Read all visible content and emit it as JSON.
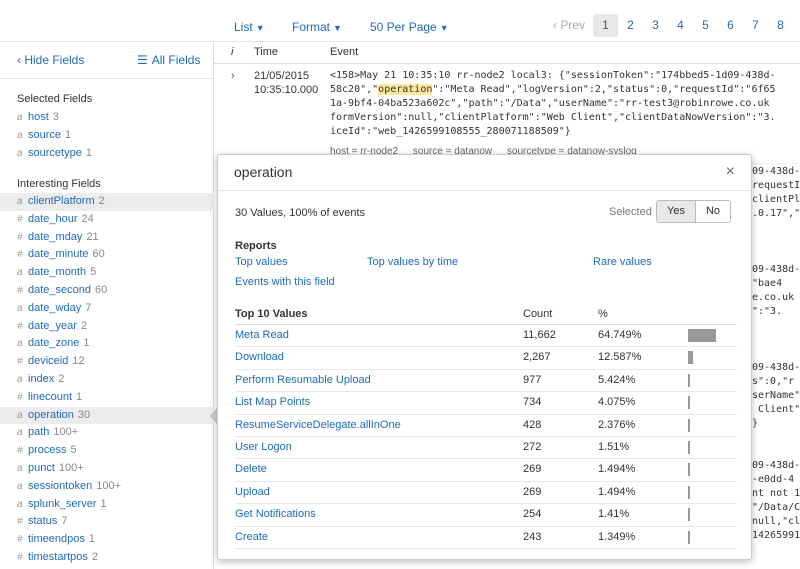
{
  "toolbar": {
    "list_label": "List",
    "format_label": "Format",
    "per_page_label": "50 Per Page",
    "prev_label": "‹ Prev",
    "pages": [
      "1",
      "2",
      "3",
      "4",
      "5",
      "6",
      "7",
      "8"
    ],
    "active_page": "1"
  },
  "sidebar": {
    "hide_fields": "‹ Hide Fields",
    "all_fields": "All Fields",
    "selected_heading": "Selected Fields",
    "selected": [
      {
        "type": "a",
        "name": "host",
        "count": "3"
      },
      {
        "type": "a",
        "name": "source",
        "count": "1"
      },
      {
        "type": "a",
        "name": "sourcetype",
        "count": "1"
      }
    ],
    "interesting_heading": "Interesting Fields",
    "interesting": [
      {
        "type": "a",
        "name": "clientPlatform",
        "count": "2"
      },
      {
        "type": "#",
        "name": "date_hour",
        "count": "24"
      },
      {
        "type": "#",
        "name": "date_mday",
        "count": "21"
      },
      {
        "type": "#",
        "name": "date_minute",
        "count": "60"
      },
      {
        "type": "a",
        "name": "date_month",
        "count": "5"
      },
      {
        "type": "#",
        "name": "date_second",
        "count": "60"
      },
      {
        "type": "a",
        "name": "date_wday",
        "count": "7"
      },
      {
        "type": "#",
        "name": "date_year",
        "count": "2"
      },
      {
        "type": "a",
        "name": "date_zone",
        "count": "1"
      },
      {
        "type": "#",
        "name": "deviceid",
        "count": "12"
      },
      {
        "type": "a",
        "name": "index",
        "count": "2"
      },
      {
        "type": "#",
        "name": "linecount",
        "count": "1"
      },
      {
        "type": "a",
        "name": "operation",
        "count": "30"
      },
      {
        "type": "a",
        "name": "path",
        "count": "100+"
      },
      {
        "type": "#",
        "name": "process",
        "count": "5"
      },
      {
        "type": "a",
        "name": "punct",
        "count": "100+"
      },
      {
        "type": "a",
        "name": "sessiontoken",
        "count": "100+"
      },
      {
        "type": "a",
        "name": "splunk_server",
        "count": "1"
      },
      {
        "type": "#",
        "name": "status",
        "count": "7"
      },
      {
        "type": "#",
        "name": "timeendpos",
        "count": "1"
      },
      {
        "type": "#",
        "name": "timestartpos",
        "count": "2"
      }
    ]
  },
  "events": {
    "col_i": "i",
    "col_time": "Time",
    "col_event": "Event",
    "first": {
      "expand": "›",
      "date": "21/05/2015",
      "time": "10:35:10.000",
      "line1_pre": "<158>May 21 10:35:10 rr-node2 local3: {\"sessionToken\":\"174bbed5-1d09-438d-",
      "line2_a": "58c20\",\"",
      "line2_hl": "operation",
      "line2_b": "\":\"Meta Read\",\"logVersion\":2,\"status\":0,\"requestId\":\"6f65",
      "line3": "1a-9bf4-04ba523a602c\",\"path\":\"/Data\",\"userName\":\"rr-test3@robinrowe.co.uk",
      "line4": "formVersion\":null,\"clientPlatform\":\"Web Client\",\"clientDataNowVersion\":\"3.",
      "line5": "iceId\":\"web_1426599108555_280071188509\"}",
      "meta_host": "host = rr-node2",
      "meta_source": "source = datanow",
      "meta_sourcetype": "sourcetype = datanow-syslog"
    },
    "bg": [
      "09-438d-",
      "requestId\"",
      "clientPl",
      ".0.17\",\"",
      "09-438d-",
      "\"bae4",
      "e.co.uk",
      "\":\"3.",
      "09-438d-",
      "s\":0,\"r",
      "serName\"",
      " Client\"",
      "}",
      "09-438d-",
      "-e0dd-4",
      "nt not 1",
      "\"/Data/C",
      "null,\"cli",
      "14265991"
    ]
  },
  "popup": {
    "title": "operation",
    "close": "×",
    "summary": "30 Values, 100% of events",
    "selected_label": "Selected",
    "yes": "Yes",
    "no": "No",
    "reports_heading": "Reports",
    "top_values": "Top values",
    "top_values_by_time": "Top values by time",
    "rare_values": "Rare values",
    "events_with_field": "Events with this field",
    "top10_heading": "Top 10 Values",
    "count_heading": "Count",
    "pct_heading": "%",
    "values": [
      {
        "name": "Meta Read",
        "count": "11,662",
        "pct": "64.749%",
        "fraction": 0.64749
      },
      {
        "name": "Download",
        "count": "2,267",
        "pct": "12.587%",
        "fraction": 0.12587
      },
      {
        "name": "Perform Resumable Upload",
        "count": "977",
        "pct": "5.424%",
        "fraction": 0.05424
      },
      {
        "name": "List Map Points",
        "count": "734",
        "pct": "4.075%",
        "fraction": 0.04075
      },
      {
        "name": "ResumeServiceDelegate.allInOne",
        "count": "428",
        "pct": "2.376%",
        "fraction": 0.02376
      },
      {
        "name": "User Logon",
        "count": "272",
        "pct": "1.51%",
        "fraction": 0.0151
      },
      {
        "name": "Delete",
        "count": "269",
        "pct": "1.494%",
        "fraction": 0.01494
      },
      {
        "name": "Upload",
        "count": "269",
        "pct": "1.494%",
        "fraction": 0.01494
      },
      {
        "name": "Get Notifications",
        "count": "254",
        "pct": "1.41%",
        "fraction": 0.0141
      },
      {
        "name": "Create",
        "count": "243",
        "pct": "1.349%",
        "fraction": 0.01349
      }
    ]
  }
}
